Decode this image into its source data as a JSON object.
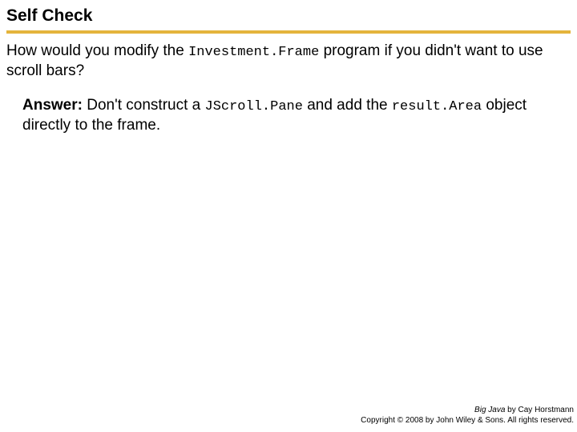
{
  "title": "Self Check",
  "question": {
    "part1": "How would you modify the ",
    "code1": "Investment.Frame",
    "part2": " program if you didn't want to use scroll bars?"
  },
  "answer": {
    "label": "Answer:",
    "part1": " Don't construct a ",
    "code1": "JScroll.Pane",
    "part2": " and add the ",
    "code2": "result.Area",
    "part3": " object directly to the frame."
  },
  "footer": {
    "book": "Big Java",
    "by": " by Cay Horstmann",
    "copyright": "Copyright © 2008 by John Wiley & Sons. All rights reserved."
  }
}
